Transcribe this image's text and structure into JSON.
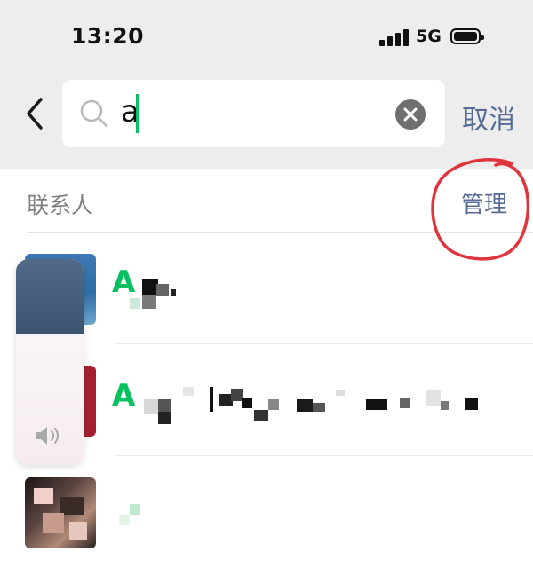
{
  "status_bar": {
    "time": "13:20",
    "network": "5G",
    "signal_bars": 4,
    "battery_icon": "battery-full-icon"
  },
  "search": {
    "back_icon": "chevron-left-icon",
    "search_icon": "search-icon",
    "query": "a",
    "clear_icon": "clear-circle-icon",
    "cancel_label": "取消"
  },
  "contacts_section": {
    "title": "联系人",
    "manage_label": "管理"
  },
  "results": [
    {
      "highlight": "A",
      "obscured": true
    },
    {
      "highlight": "A",
      "obscured": true
    },
    {
      "highlight": "",
      "obscured": true
    }
  ],
  "volume_hud": {
    "level": 0.36,
    "icon": "speaker-icon"
  },
  "colors": {
    "accent_green": "#07c160",
    "link_blue": "#576b95",
    "annotation_red": "#e0343c",
    "top_background": "#ededed"
  }
}
